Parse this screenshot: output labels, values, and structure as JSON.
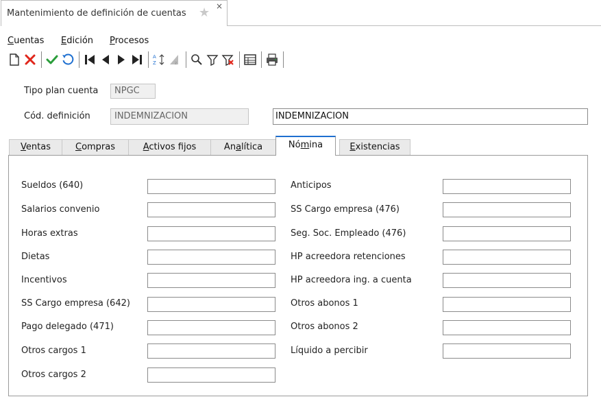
{
  "window": {
    "title": "Mantenimiento de definición de cuentas",
    "star_icon": "star-icon",
    "close_icon": "×"
  },
  "menu": {
    "items": [
      {
        "accel": "C",
        "rest": "uentas"
      },
      {
        "accel": "E",
        "rest": "dición"
      },
      {
        "accel": "P",
        "rest": "rocesos"
      }
    ]
  },
  "toolbar": {
    "icons": [
      "new-icon",
      "delete-icon",
      "accept-icon",
      "undo-icon",
      "first-icon",
      "previous-icon",
      "next-icon",
      "last-icon",
      "sort-icon",
      "sort-clear-icon",
      "search-icon",
      "filter-icon",
      "filter-clear-icon",
      "grid-icon",
      "print-icon"
    ],
    "colors": {
      "delete": "#e0261b",
      "accept": "#2a9d3a",
      "undo": "#1e6fd0",
      "nav": "#222222"
    }
  },
  "header": {
    "tipo_plan_label": "Tipo plan cuenta",
    "tipo_plan_value": "NPGC",
    "cod_def_label": "Cód. definición",
    "cod_def_value": "INDEMNIZACION",
    "description_value": "INDEMNIZACION"
  },
  "tabs": [
    {
      "pre": "",
      "accel": "V",
      "rest": "entas",
      "active": false
    },
    {
      "pre": "",
      "accel": "C",
      "rest": "ompras",
      "active": false
    },
    {
      "pre": "",
      "accel": "A",
      "rest": "ctivos fijos",
      "active": false
    },
    {
      "pre": "An",
      "accel": "a",
      "rest": "lítica",
      "active": false
    },
    {
      "pre": "Nó",
      "accel": "m",
      "rest": "ina",
      "active": true
    },
    {
      "pre": "",
      "accel": "E",
      "rest": "xistencias",
      "active": false
    }
  ],
  "fields": {
    "left": [
      {
        "label": "Sueldos (640)",
        "value": ""
      },
      {
        "label": "Salarios convenio",
        "value": ""
      },
      {
        "label": "Horas extras",
        "value": ""
      },
      {
        "label": "Dietas",
        "value": ""
      },
      {
        "label": "Incentivos",
        "value": ""
      },
      {
        "label": "SS Cargo empresa (642)",
        "value": ""
      },
      {
        "label": "Pago delegado (471)",
        "value": ""
      },
      {
        "label": "Otros cargos 1",
        "value": ""
      },
      {
        "label": "Otros cargos 2",
        "value": ""
      }
    ],
    "right": [
      {
        "label": "Anticipos",
        "value": ""
      },
      {
        "label": "SS Cargo empresa (476)",
        "value": ""
      },
      {
        "label": "Seg. Soc. Empleado (476)",
        "value": ""
      },
      {
        "label": "HP acreedora retenciones",
        "value": ""
      },
      {
        "label": "HP acreedora ing. a cuenta",
        "value": ""
      },
      {
        "label": "Otros abonos 1",
        "value": ""
      },
      {
        "label": "Otros abonos 2",
        "value": ""
      },
      {
        "label": "Líquido a percibir",
        "value": ""
      }
    ]
  }
}
